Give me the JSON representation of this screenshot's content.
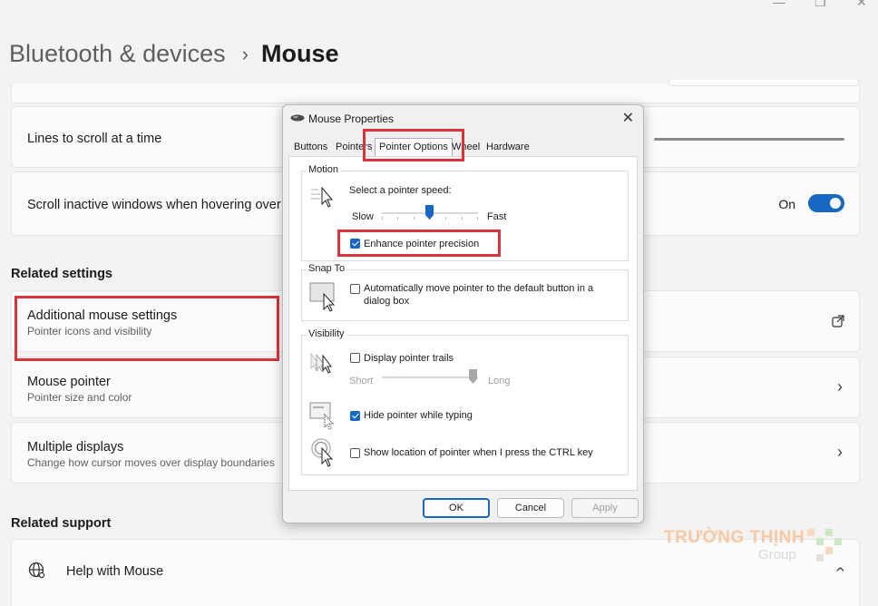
{
  "breadcrumb": {
    "parent": "Bluetooth & devices",
    "current": "Mouse"
  },
  "settings": {
    "lines_to_scroll": {
      "title": "Lines to scroll at a time"
    },
    "scroll_inactive": {
      "title": "Scroll inactive windows when hovering over them",
      "toggle_label": "On",
      "toggle_on": true
    }
  },
  "related_settings": {
    "header": "Related settings",
    "items": [
      {
        "title": "Additional mouse settings",
        "subtitle": "Pointer icons and visibility",
        "icon": "external-link-icon"
      },
      {
        "title": "Mouse pointer",
        "subtitle": "Pointer size and color",
        "icon": "chevron-right-icon"
      },
      {
        "title": "Multiple displays",
        "subtitle": "Change how cursor moves over display boundaries",
        "icon": "chevron-right-icon"
      }
    ]
  },
  "related_support": {
    "header": "Related support",
    "items": [
      {
        "title": "Help with Mouse",
        "icon": "globe-icon"
      }
    ]
  },
  "dialog": {
    "title": "Mouse Properties",
    "tabs": [
      "Buttons",
      "Pointers",
      "Pointer Options",
      "Wheel",
      "Hardware"
    ],
    "active_tab": "Pointer Options",
    "motion": {
      "label": "Motion",
      "speed_label": "Select a pointer speed:",
      "slow": "Slow",
      "fast": "Fast",
      "speed_value": 0.5,
      "enhance_precision": {
        "label": "Enhance pointer precision",
        "checked": true
      }
    },
    "snap_to": {
      "label": "Snap To",
      "auto_move": {
        "label": "Automatically move pointer to the default button in a dialog box",
        "line1": "Automatically move pointer to the default button in a",
        "line2": "dialog box",
        "checked": false
      }
    },
    "visibility": {
      "label": "Visibility",
      "trails": {
        "label": "Display pointer trails",
        "checked": false,
        "short": "Short",
        "long": "Long",
        "value": 1.0
      },
      "hide_typing": {
        "label": "Hide pointer while typing",
        "checked": true
      },
      "show_location": {
        "label": "Show location of pointer when I press the CTRL key",
        "checked": false
      }
    },
    "buttons": {
      "ok": "OK",
      "cancel": "Cancel",
      "apply": "Apply"
    }
  },
  "watermark": {
    "brand": "TRƯỜNG THỊNH",
    "sub": "Group"
  },
  "colors": {
    "accent": "#1867c0",
    "highlight": "#d9343a"
  }
}
